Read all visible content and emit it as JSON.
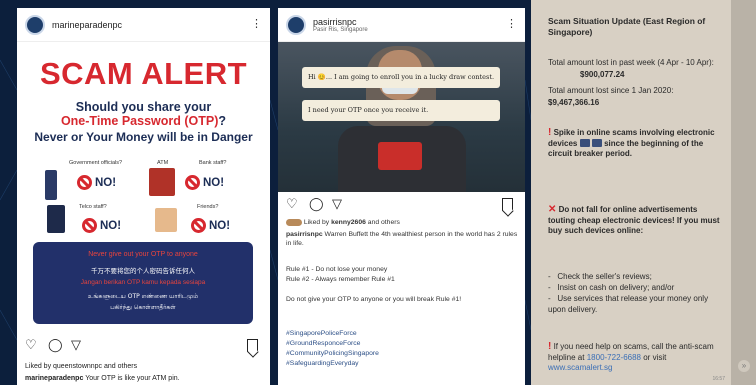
{
  "colors": {
    "background": "#0c1f3c",
    "alert_red": "#d7282f",
    "navy": "#1c2d55",
    "box": "#22306a",
    "chat_bg": "#d8d0c4"
  },
  "post1": {
    "username": "marineparadenpc",
    "title": "SCAM ALERT",
    "question_line1": "Should you share your",
    "question_line2_red": "One-Time Password (OTP)",
    "question_line2_end": "?",
    "question_line3": "Never or Your Money will be in Danger",
    "items": [
      {
        "label": "Government officials?",
        "answer": "NO!"
      },
      {
        "label": "ATM",
        "answer": ""
      },
      {
        "label": "Bank staff?",
        "answer": "NO!"
      },
      {
        "label": "Telco staff?",
        "answer": "NO!"
      },
      {
        "label": "Friends?",
        "answer": "NO!"
      }
    ],
    "box_lines": [
      "Never give out your OTP to anyone",
      "千万不要将您的个人密码告诉任何人",
      "Jangan berikan OTP kamu kepada sesiapa",
      "உங்களுடைய OTP எண்ணை யாரிடமும்",
      "பகிர்ந்து கொள்ளாதீர்கள்"
    ],
    "liked_by": "Liked by queenstownnpc and others",
    "caption_user": "marineparadenpc",
    "caption_text": "Your OTP is like your ATM pin."
  },
  "post2": {
    "username": "pasirrisnpc",
    "location": "Pasir Ris, Singapore",
    "bubble1": "Hi 😊... I am going to enroll you in a lucky draw contest.",
    "bubble2": "I need your OTP once you receive it.",
    "liked_by_prefix": "Liked by",
    "liked_by_user": "kenny2606",
    "liked_by_suffix": "and others",
    "caption_user": "pasirrisnpc",
    "caption_text": "Warren Buffett the 4th wealthiest person in the world has 2 rules in life.",
    "rule1": "Rule #1 - Do not lose your money",
    "rule2": "Rule #2 - Always remember Rule #1",
    "body": "Do not give your OTP to anyone or you will break Rule #1!",
    "hashtags": [
      "#SingaporePoliceForce",
      "#GroundResponceForce",
      "#CommunityPolicingSingapore",
      "#SafeguardingEveryday"
    ]
  },
  "chat": {
    "title": "Scam Situation Update (East Region of Singapore)",
    "week_label": "Total amount lost in past week (4 Apr - 10 Apr):",
    "week_value": "$900,077.24",
    "since_label": "Total amount lost since 1 Jan 2020:",
    "since_value": "$9,467,366.16",
    "spike_text": "Spike in online scams involving electronic devices",
    "spike_end": "since the beginning of the circuit breaker period.",
    "fall_text": "Do not fall for online advertisements touting cheap electronic devices! If you must buy such devices online:",
    "bullets": [
      "Check the seller's reviews;",
      "Insist on cash on delivery; and/or",
      "Use services that release your money only upon delivery."
    ],
    "help_text": "If you need help on scams, call the anti-scam helpline at",
    "help_phone": "1800-722-6688",
    "help_or": "or visit",
    "help_site": "www.scamalert.sg",
    "time": "16:57"
  }
}
